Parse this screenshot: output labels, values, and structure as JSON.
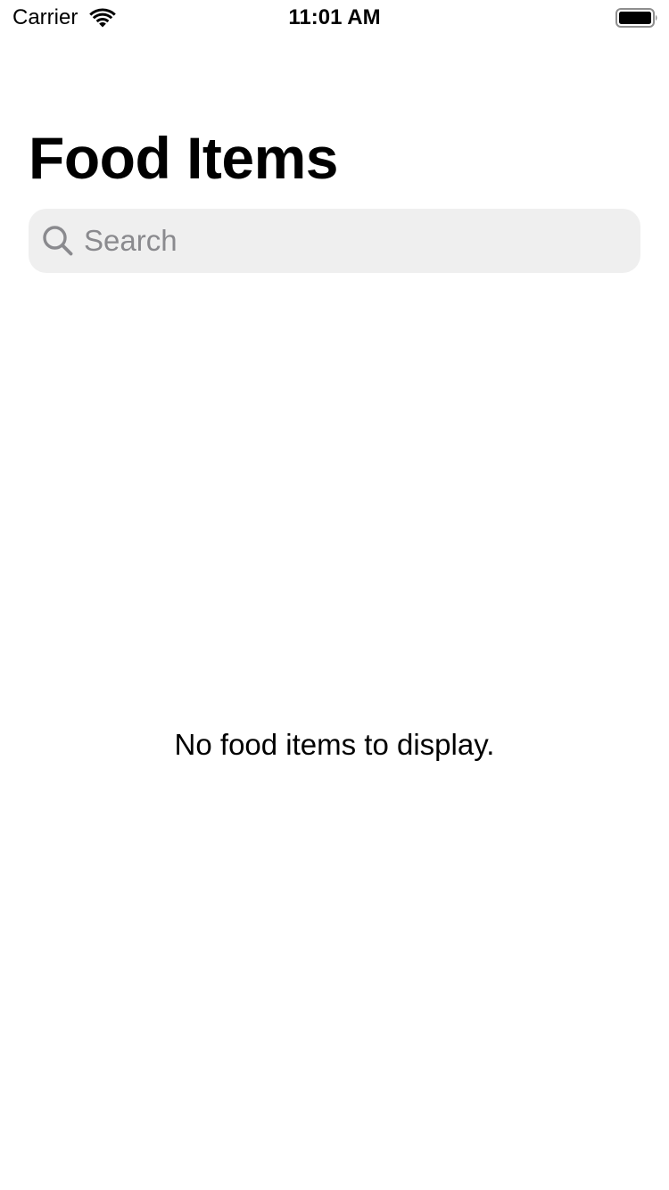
{
  "status_bar": {
    "carrier": "Carrier",
    "time": "11:01 AM",
    "wifi_icon": "wifi-icon",
    "battery_icon": "battery-full-icon"
  },
  "header": {
    "title": "Food Items"
  },
  "search": {
    "placeholder": "Search",
    "value": "",
    "icon": "magnifying-glass-icon"
  },
  "content": {
    "empty_message": "No food items to display."
  },
  "colors": {
    "background": "#ffffff",
    "search_field_bg": "#efefef",
    "placeholder": "#8a8a8e",
    "text": "#000000"
  }
}
